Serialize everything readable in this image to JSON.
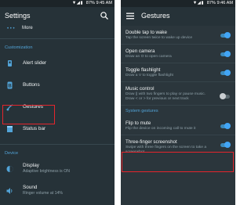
{
  "left_screen": {
    "status": {
      "battery": "87%",
      "time": "9:45 AM"
    },
    "title": "Settings",
    "more_label": "More",
    "section_customization": "Customization",
    "items": [
      {
        "label": "Alert slider"
      },
      {
        "label": "Buttons"
      },
      {
        "label": "Gestures"
      },
      {
        "label": "Status bar"
      }
    ],
    "section_device": "Device",
    "device_items": [
      {
        "label": "Display",
        "sub": "Adaptive brightness is ON"
      },
      {
        "label": "Sound",
        "sub": "Ringer volume at 14%"
      }
    ]
  },
  "right_screen": {
    "status": {
      "battery": "87%",
      "time": "9:46 AM"
    },
    "title": "Gestures",
    "items": [
      {
        "title": "Double tap to wake",
        "sub": "Tap the screen twice to wake up device",
        "on": true
      },
      {
        "title": "Open camera",
        "sub": "Draw an O to open camera",
        "on": true
      },
      {
        "title": "Toggle flashlight",
        "sub": "Draw a V to toggle flashlight",
        "on": true
      },
      {
        "title": "Music control",
        "sub": "Draw || with two fingers to play or pause music. Draw < or > for previous or next track",
        "on": false
      }
    ],
    "section_system": "System gestures",
    "system_items": [
      {
        "title": "Flip to mute",
        "sub": "Flip the device on incoming call to mute it",
        "on": true
      },
      {
        "title": "Three-finger screenshot",
        "sub": "Swipe with three fingers on the screen to take a screenshot",
        "on": true
      }
    ]
  },
  "colors": {
    "accent": "#52a4d8",
    "toggle_on": "#42a5f5",
    "highlight": "#e5252c",
    "background": "#263238"
  }
}
